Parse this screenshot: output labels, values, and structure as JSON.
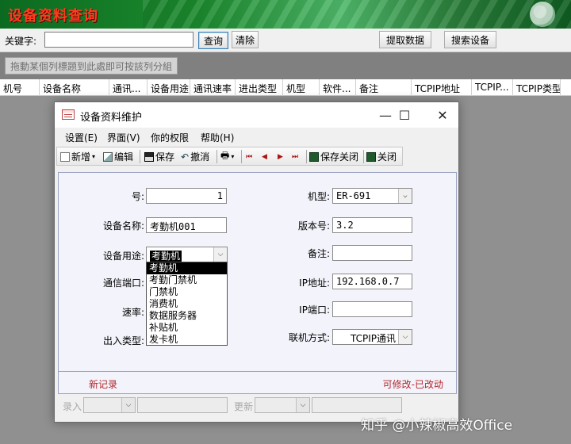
{
  "app": {
    "banner_title": "设备资料查询"
  },
  "search": {
    "keyword_label": "关键字:",
    "keyword_value": "",
    "query_button": "查询",
    "clear_button": "清除",
    "fetch_button": "提取数据",
    "device_search_button": "搜索设备"
  },
  "group_panel": {
    "hint": "拖動某個列標題到此處即可按該列分組"
  },
  "grid": {
    "columns": [
      "机号",
      "设备名称",
      "通讯...",
      "设备用途",
      "通讯速率",
      "进出类型",
      "机型",
      "软件...",
      "备注",
      "TCPIP地址",
      "TCPIP...",
      "TCPIP类型"
    ]
  },
  "dialog": {
    "title": "设备资料维护",
    "window_buttons": {
      "minimize": "—",
      "maximize": "☐",
      "close": "✕"
    },
    "menu": [
      "设置(E)",
      "界面(V)",
      "你的权限",
      "帮助(H)"
    ],
    "toolbar": {
      "new": "新增",
      "edit": "编辑",
      "save": "保存",
      "undo": "撤消",
      "print_symbol": "🖶",
      "nav_first": "⏮",
      "nav_prev": "◀",
      "nav_next": "▶",
      "nav_last": "⏭",
      "save_close": "保存关闭",
      "close": "关闭"
    },
    "form": {
      "number_label": "号:",
      "number_value": "1",
      "name_label": "设备名称:",
      "name_value": "考勤机001",
      "purpose_label": "设备用途:",
      "purpose_value": "考勤机",
      "port_label": "通信端口:",
      "speed_label": "速率:",
      "io_type_label": "出入类型:",
      "model_label": "机型:",
      "model_value": "ER-691",
      "version_label": "版本号:",
      "version_value": "3.2",
      "note_label": "备注:",
      "note_value": "",
      "ip_label": "IP地址:",
      "ip_value": "192.168.0.7",
      "ip_port_label": "IP端口:",
      "ip_port_value": "",
      "connect_label": "联机方式:",
      "connect_value": "TCPIP通讯"
    },
    "purpose_options": [
      "考勤机",
      "考勤门禁机",
      "门禁机",
      "消费机",
      "数据服务器",
      "补贴机",
      "发卡机"
    ],
    "status": {
      "left": "新记录",
      "right": "可修改-已改动"
    },
    "audit": {
      "entry_label": "录入",
      "update_label": "更新"
    }
  },
  "watermark": "知乎 @小辣椒高效Office",
  "colors": {
    "banner_title": "#ff3b1f",
    "status_text": "#b2262a",
    "banner_green": "#1c8a2e"
  }
}
